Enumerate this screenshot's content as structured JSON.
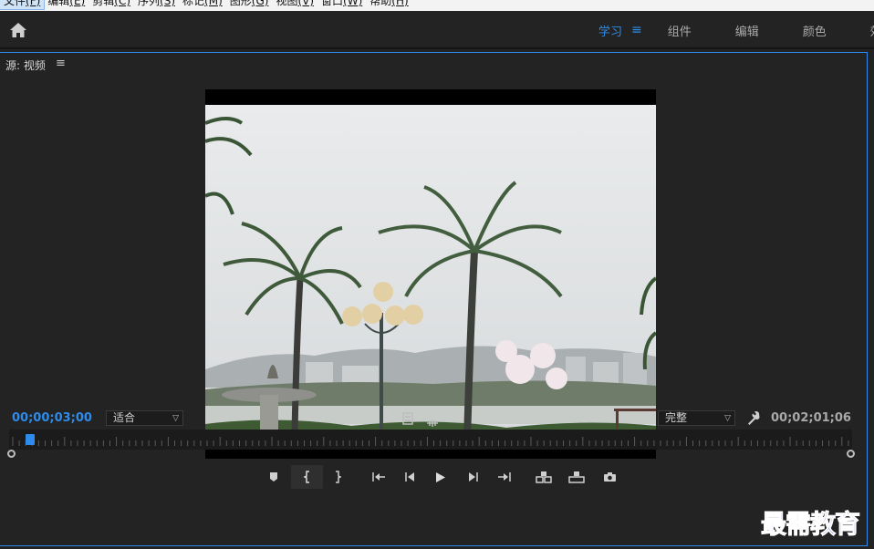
{
  "menubar": {
    "items": [
      {
        "label": "文件",
        "key": "(F)"
      },
      {
        "label": "编辑",
        "key": "(E)"
      },
      {
        "label": "剪辑",
        "key": "(C)"
      },
      {
        "label": "序列",
        "key": "(S)"
      },
      {
        "label": "标记",
        "key": "(M)"
      },
      {
        "label": "图形",
        "key": "(G)"
      },
      {
        "label": "视图",
        "key": "(V)"
      },
      {
        "label": "窗口",
        "key": "(W)"
      },
      {
        "label": "帮助",
        "key": "(H)"
      }
    ]
  },
  "workspace": {
    "home_icon": "home-icon",
    "tabs": [
      {
        "label": "学习"
      },
      {
        "label": "组件"
      },
      {
        "label": "编辑"
      },
      {
        "label": "颜色"
      },
      {
        "label": "效"
      }
    ],
    "menu_glyph": "≡"
  },
  "source_panel": {
    "title": "源: 视频",
    "menu_glyph": "≡",
    "timecode_current": "00;00;03;00",
    "fit_select": "适合",
    "quality_select": "完整",
    "timecode_duration": "00;02;01;06",
    "playhead_fraction": 0.0248
  },
  "transport": {
    "buttons": [
      {
        "name": "add-marker-button",
        "icon": "marker-icon"
      },
      {
        "name": "mark-in-button",
        "icon": "mark-in-icon"
      },
      {
        "name": "mark-out-button",
        "icon": "mark-out-icon"
      },
      {
        "name": "go-to-in-button",
        "icon": "go-to-in-icon"
      },
      {
        "name": "step-back-button",
        "icon": "step-back-icon"
      },
      {
        "name": "play-button",
        "icon": "play-icon"
      },
      {
        "name": "step-forward-button",
        "icon": "step-forward-icon"
      },
      {
        "name": "go-to-out-button",
        "icon": "go-to-out-icon"
      },
      {
        "name": "insert-button",
        "icon": "insert-icon"
      },
      {
        "name": "overwrite-button",
        "icon": "overwrite-icon"
      },
      {
        "name": "export-frame-button",
        "icon": "camera-icon"
      }
    ]
  },
  "watermark": "最需教育",
  "colors": {
    "accent": "#2d8ceb",
    "panel_bg": "#232323",
    "menubar_bg": "#f3f3f3"
  }
}
